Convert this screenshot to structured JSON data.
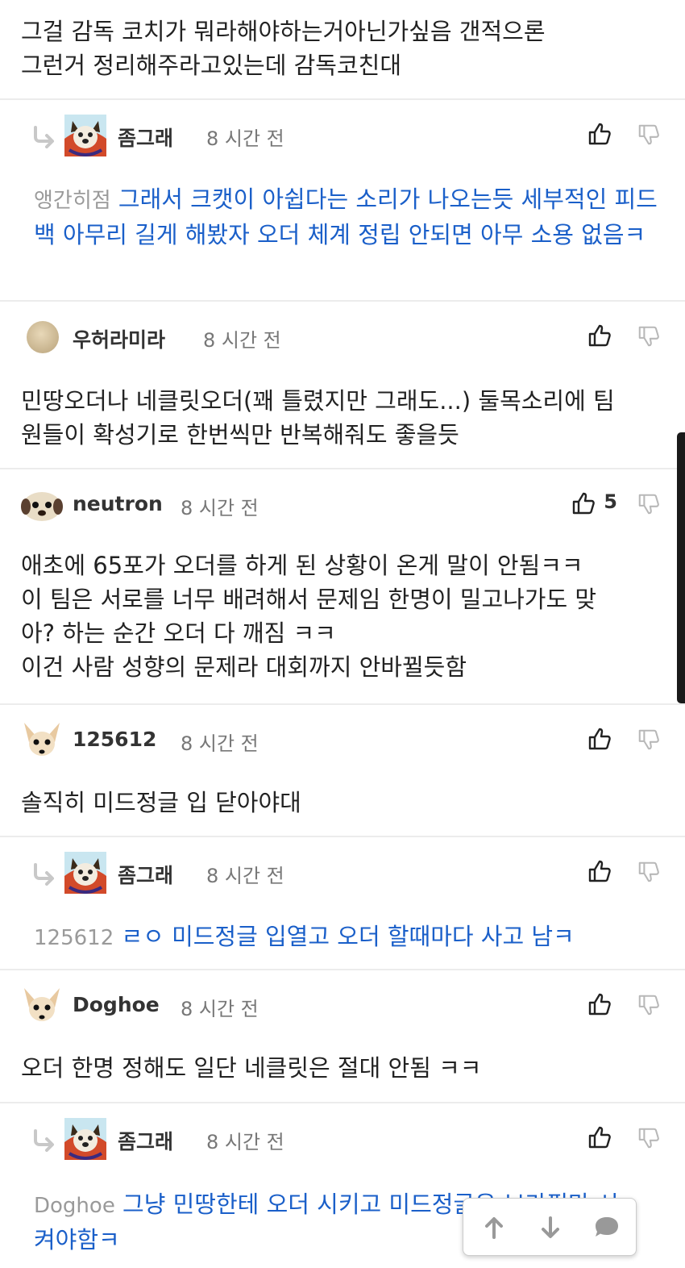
{
  "comments": [
    {
      "text_lines": [
        "그걸 감독 코치가 뭐라해야하는거아닌가싶음 갠적으론",
        "그런거 정리해주라고있는데 감독코친대"
      ]
    },
    {
      "author": "좀그래",
      "time": "8 시간 전",
      "reply_to": "앵간히점",
      "text": "그래서 크캣이 아쉽다는 소리가 나오는듯 세부적인 피드백 아무리 길게 해봤자 오더 체계 정립 안되면 아무 소용 없음ㅋ"
    },
    {
      "author": "우허라미라",
      "time": "8 시간 전",
      "text_lines": [
        "민땅오더나 네클릿오더(꽤 틀렸지만 그래도...) 둘목소리에 팀",
        "원들이 확성기로 한번씩만 반복해줘도 좋을듯"
      ]
    },
    {
      "author": "neutron",
      "time": "8 시간 전",
      "upvotes": "5",
      "text_lines": [
        "애초에 65포가 오더를 하게 된 상황이 온게 말이 안됨ㅋㅋ",
        "이 팀은 서로를 너무 배려해서 문제임 한명이 밀고나가도 맞",
        "아? 하는 순간 오더 다 깨짐 ㅋㅋ",
        "이건 사람 성향의 문제라 대회까지 안바뀔듯함"
      ]
    },
    {
      "author": "125612",
      "time": "8 시간 전",
      "text_lines": [
        "솔직히 미드정글 입 닫아야대"
      ]
    },
    {
      "author": "좀그래",
      "time": "8 시간 전",
      "reply_to": "125612",
      "text": "ㄹㅇ 미드정글 입열고 오더 할때마다 사고 남ㅋ"
    },
    {
      "author": "Doghoe",
      "time": "8 시간 전",
      "text_lines": [
        "오더 한명 정해도 일단 네클릿은 절대 안됨 ㅋㅋ"
      ]
    },
    {
      "author": "좀그래",
      "time": "8 시간 전",
      "reply_to": "Doghoe",
      "text_lines": [
        "그냥 민땅한테 오더 시키고 미드정글은 보라필만 시",
        "켜야함ㅋ"
      ]
    }
  ],
  "colors": {
    "reply_text": "#1a5fc9",
    "divider": "#ececec",
    "meta": "#777777"
  },
  "icons": {
    "upvote": "thumbs-up-icon",
    "downvote": "thumbs-down-icon",
    "reply": "reply-arrow-icon",
    "scroll_up": "arrow-up-icon",
    "scroll_down": "arrow-down-icon",
    "comment": "speech-bubble-icon"
  }
}
